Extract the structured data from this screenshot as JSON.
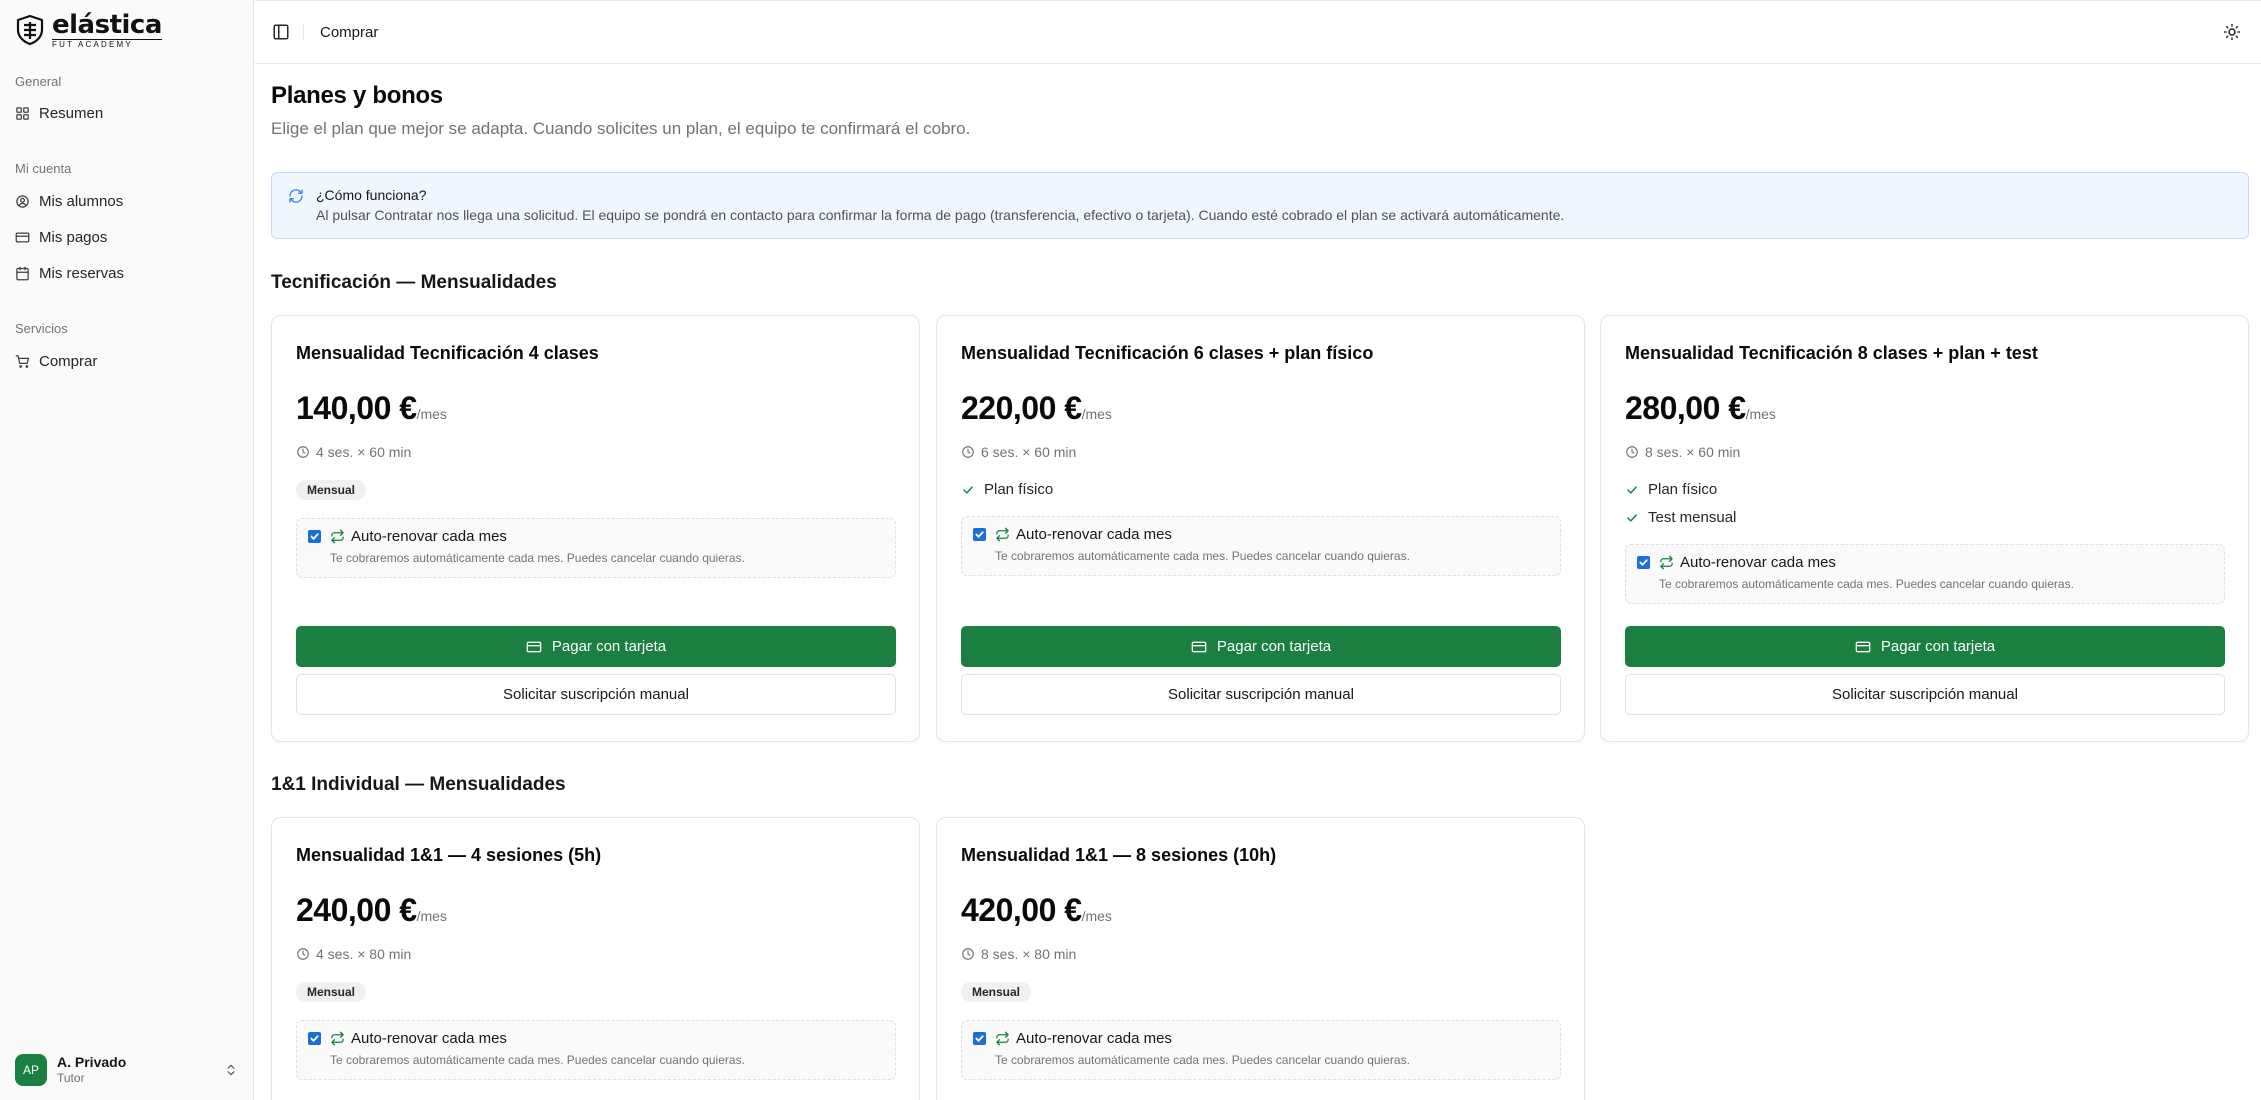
{
  "brand": {
    "word": "elástica",
    "sub": "FUT ACADEMY"
  },
  "sidebar": {
    "groups": [
      {
        "label": "General",
        "items": [
          {
            "label": "Resumen",
            "icon": "grid-icon"
          }
        ]
      },
      {
        "label": "Mi cuenta",
        "items": [
          {
            "label": "Mis alumnos",
            "icon": "users-icon"
          },
          {
            "label": "Mis pagos",
            "icon": "credit-card-icon"
          },
          {
            "label": "Mis reservas",
            "icon": "calendar-icon"
          }
        ]
      },
      {
        "label": "Servicios",
        "items": [
          {
            "label": "Comprar",
            "icon": "cart-icon"
          }
        ]
      }
    ]
  },
  "user": {
    "initials": "AP",
    "name": "A. Privado",
    "role": "Tutor"
  },
  "header": {
    "title": "Comprar"
  },
  "page": {
    "title": "Planes y bonos",
    "subtitle": "Elige el plan que mejor se adapta. Cuando solicites un plan, el equipo te confirmará el cobro."
  },
  "info": {
    "title": "¿Cómo funciona?",
    "text": "Al pulsar Contratar nos llega una solicitud. El equipo se pondrá en contacto para confirmar la forma de pago (transferencia, efectivo o tarjeta). Cuando esté cobrado el plan se activará automáticamente."
  },
  "common": {
    "unit": "/mes",
    "renew_label": "Auto-renovar cada mes",
    "renew_help": "Te cobraremos automáticamente cada mes. Puedes cancelar cuando quieras.",
    "pay_label": "Pagar con tarjeta",
    "manual_label": "Solicitar suscripción manual"
  },
  "sections": [
    {
      "title": "Tecnificación — Mensualidades",
      "plans": [
        {
          "name": "Mensualidad Tecnificación 4 clases",
          "price": "140,00 €",
          "duration": "4 ses. × 60 min",
          "badge": "Mensual",
          "features": []
        },
        {
          "name": "Mensualidad Tecnificación 6 clases + plan físico",
          "price": "220,00 €",
          "duration": "6 ses. × 60 min",
          "badge": "",
          "features": [
            "Plan físico"
          ]
        },
        {
          "name": "Mensualidad Tecnificación 8 clases + plan + test",
          "price": "280,00 €",
          "duration": "8 ses. × 60 min",
          "badge": "",
          "features": [
            "Plan físico",
            "Test mensual"
          ]
        }
      ]
    },
    {
      "title": "1&1 Individual — Mensualidades",
      "plans": [
        {
          "name": "Mensualidad 1&1 — 4 sesiones (5h)",
          "price": "240,00 €",
          "duration": "4 ses. × 80 min",
          "badge": "Mensual",
          "features": []
        },
        {
          "name": "Mensualidad 1&1 — 8 sesiones (10h)",
          "price": "420,00 €",
          "duration": "8 ses. × 80 min",
          "badge": "Mensual",
          "features": []
        }
      ]
    }
  ],
  "colors": {
    "primary": "#1a7f3f",
    "info_bg": "#f0f6fd",
    "info_border": "#c6dbf4",
    "checkbox": "#1a6fd8",
    "renew_icon": "#1a7f3f",
    "info_icon": "#3b82f6"
  }
}
